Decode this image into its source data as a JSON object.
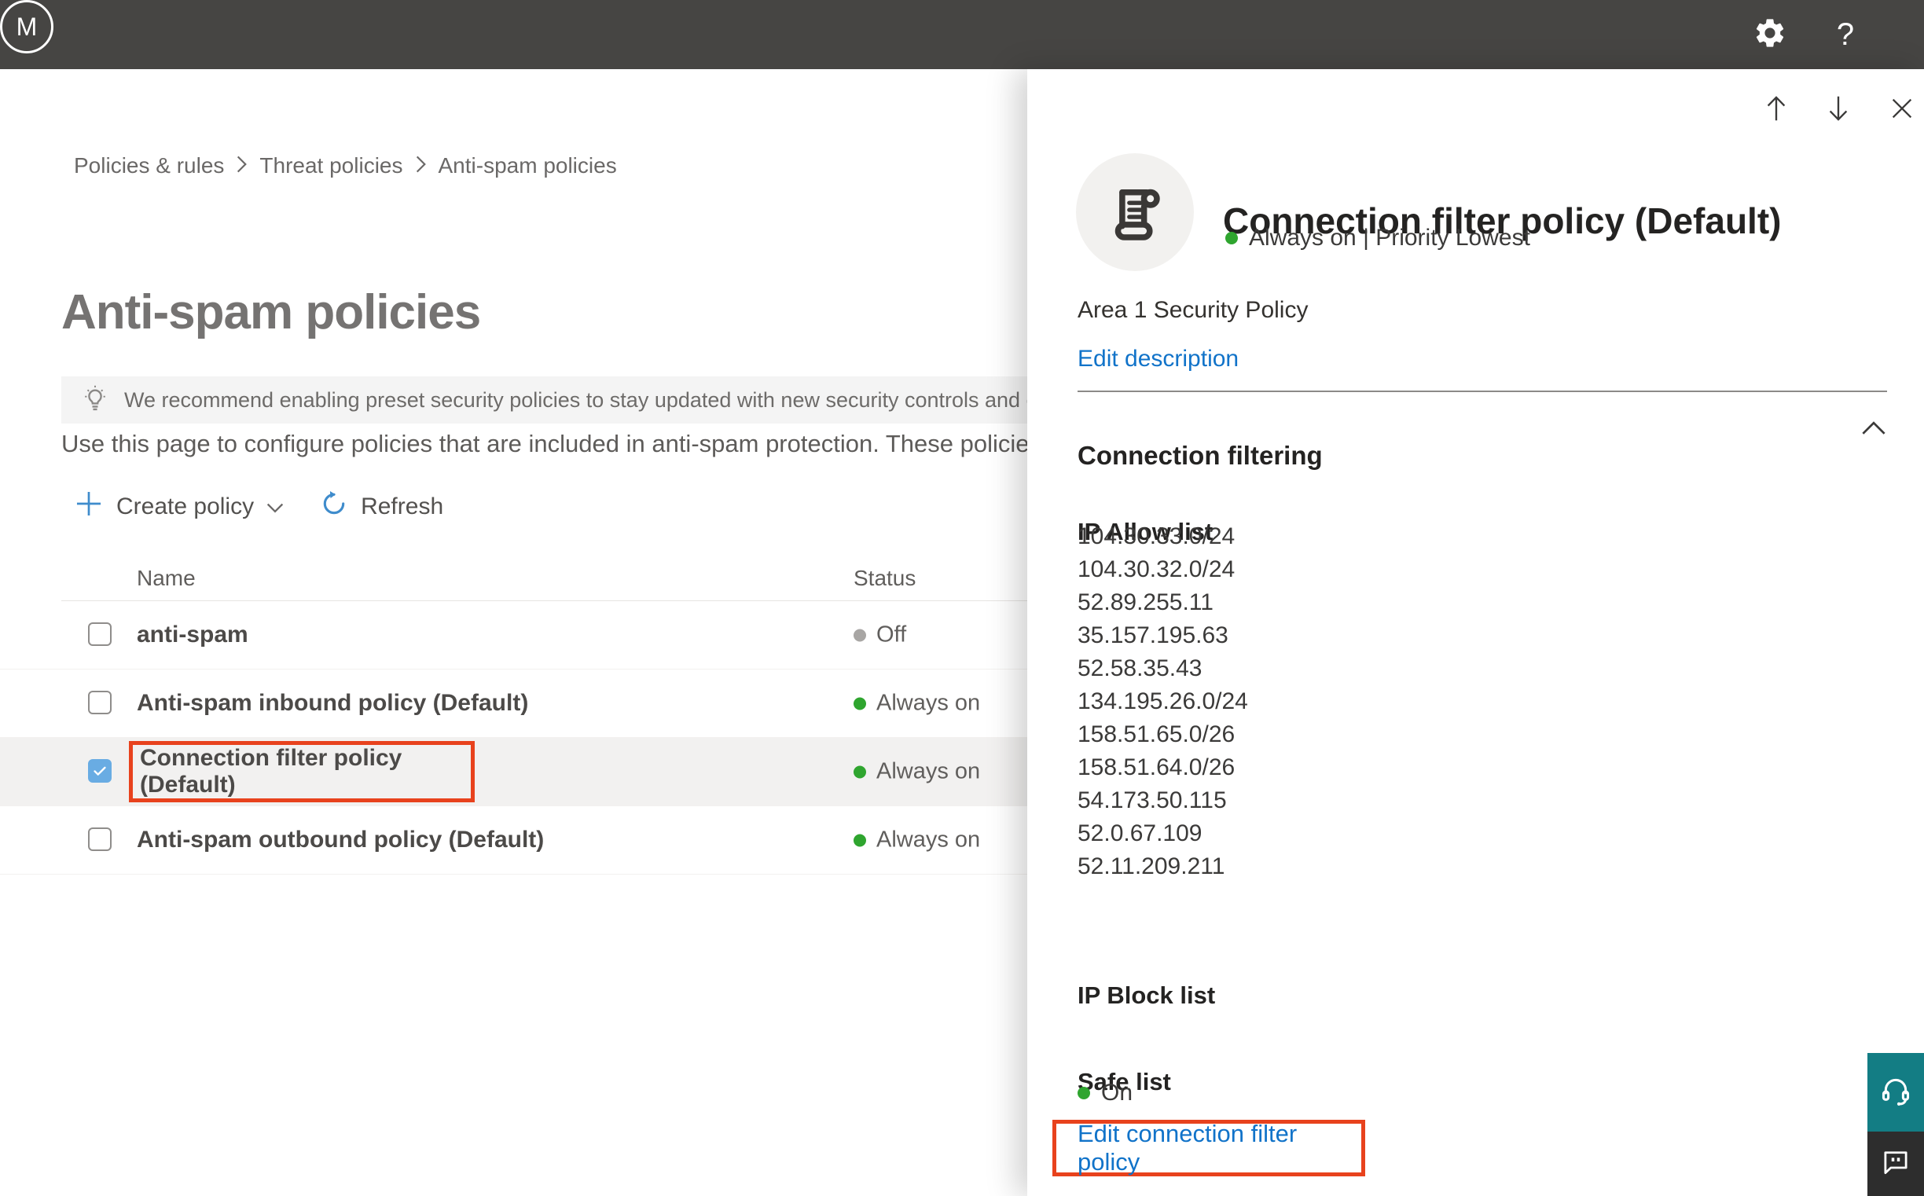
{
  "topbar": {
    "help_label": "?",
    "avatar_initial": "M"
  },
  "breadcrumb": {
    "items": [
      "Policies & rules",
      "Threat policies",
      "Anti-spam policies"
    ]
  },
  "page": {
    "title": "Anti-spam policies",
    "banner_text": "We recommend enabling preset security policies to stay updated with new security controls and our recomme",
    "intro_text": "Use this page to configure policies that are included in anti-spam protection. These policies include"
  },
  "toolbar": {
    "create_policy_label": "Create policy",
    "refresh_label": "Refresh"
  },
  "table": {
    "columns": {
      "name": "Name",
      "status": "Status"
    },
    "rows": [
      {
        "name": "anti-spam",
        "status": "Off",
        "state": "off",
        "checked": "false"
      },
      {
        "name": "Anti-spam inbound policy (Default)",
        "status": "Always on",
        "state": "on",
        "checked": "false"
      },
      {
        "name": "Connection filter policy (Default)",
        "status": "Always on",
        "state": "on",
        "checked": "true"
      },
      {
        "name": "Anti-spam outbound policy (Default)",
        "status": "Always on",
        "state": "on",
        "checked": "false"
      }
    ]
  },
  "flyout": {
    "title": "Connection filter policy (Default)",
    "status_line": "Always on | Priority Lowest",
    "description": "Area 1 Security Policy",
    "edit_description_label": "Edit description",
    "section_title": "Connection filtering",
    "ip_allow": {
      "title": "IP Allow list",
      "items": [
        "104.30.33.0/24",
        "104.30.32.0/24",
        "52.89.255.11",
        "35.157.195.63",
        "52.58.35.43",
        "134.195.26.0/24",
        "158.51.65.0/26",
        "158.51.64.0/26",
        "54.173.50.115",
        "52.0.67.109",
        "52.11.209.211"
      ]
    },
    "ip_block": {
      "title": "IP Block list"
    },
    "safe_list": {
      "title": "Safe list",
      "status": "On"
    },
    "edit_link_label": "Edit connection filter policy"
  },
  "colors": {
    "topbar_bg": "#464543",
    "accent_blue": "#1173c9",
    "toolbar_icon_blue": "#3f8ccc",
    "checkbox_blue": "#69ace3",
    "status_green": "#2fa52f",
    "status_gray_off": "#a8a6a4",
    "callout_red": "#e8421d",
    "selected_row_bg": "#f2f1f0",
    "support_teal": "#137d84",
    "feedback_dark": "#2d2d2d"
  }
}
